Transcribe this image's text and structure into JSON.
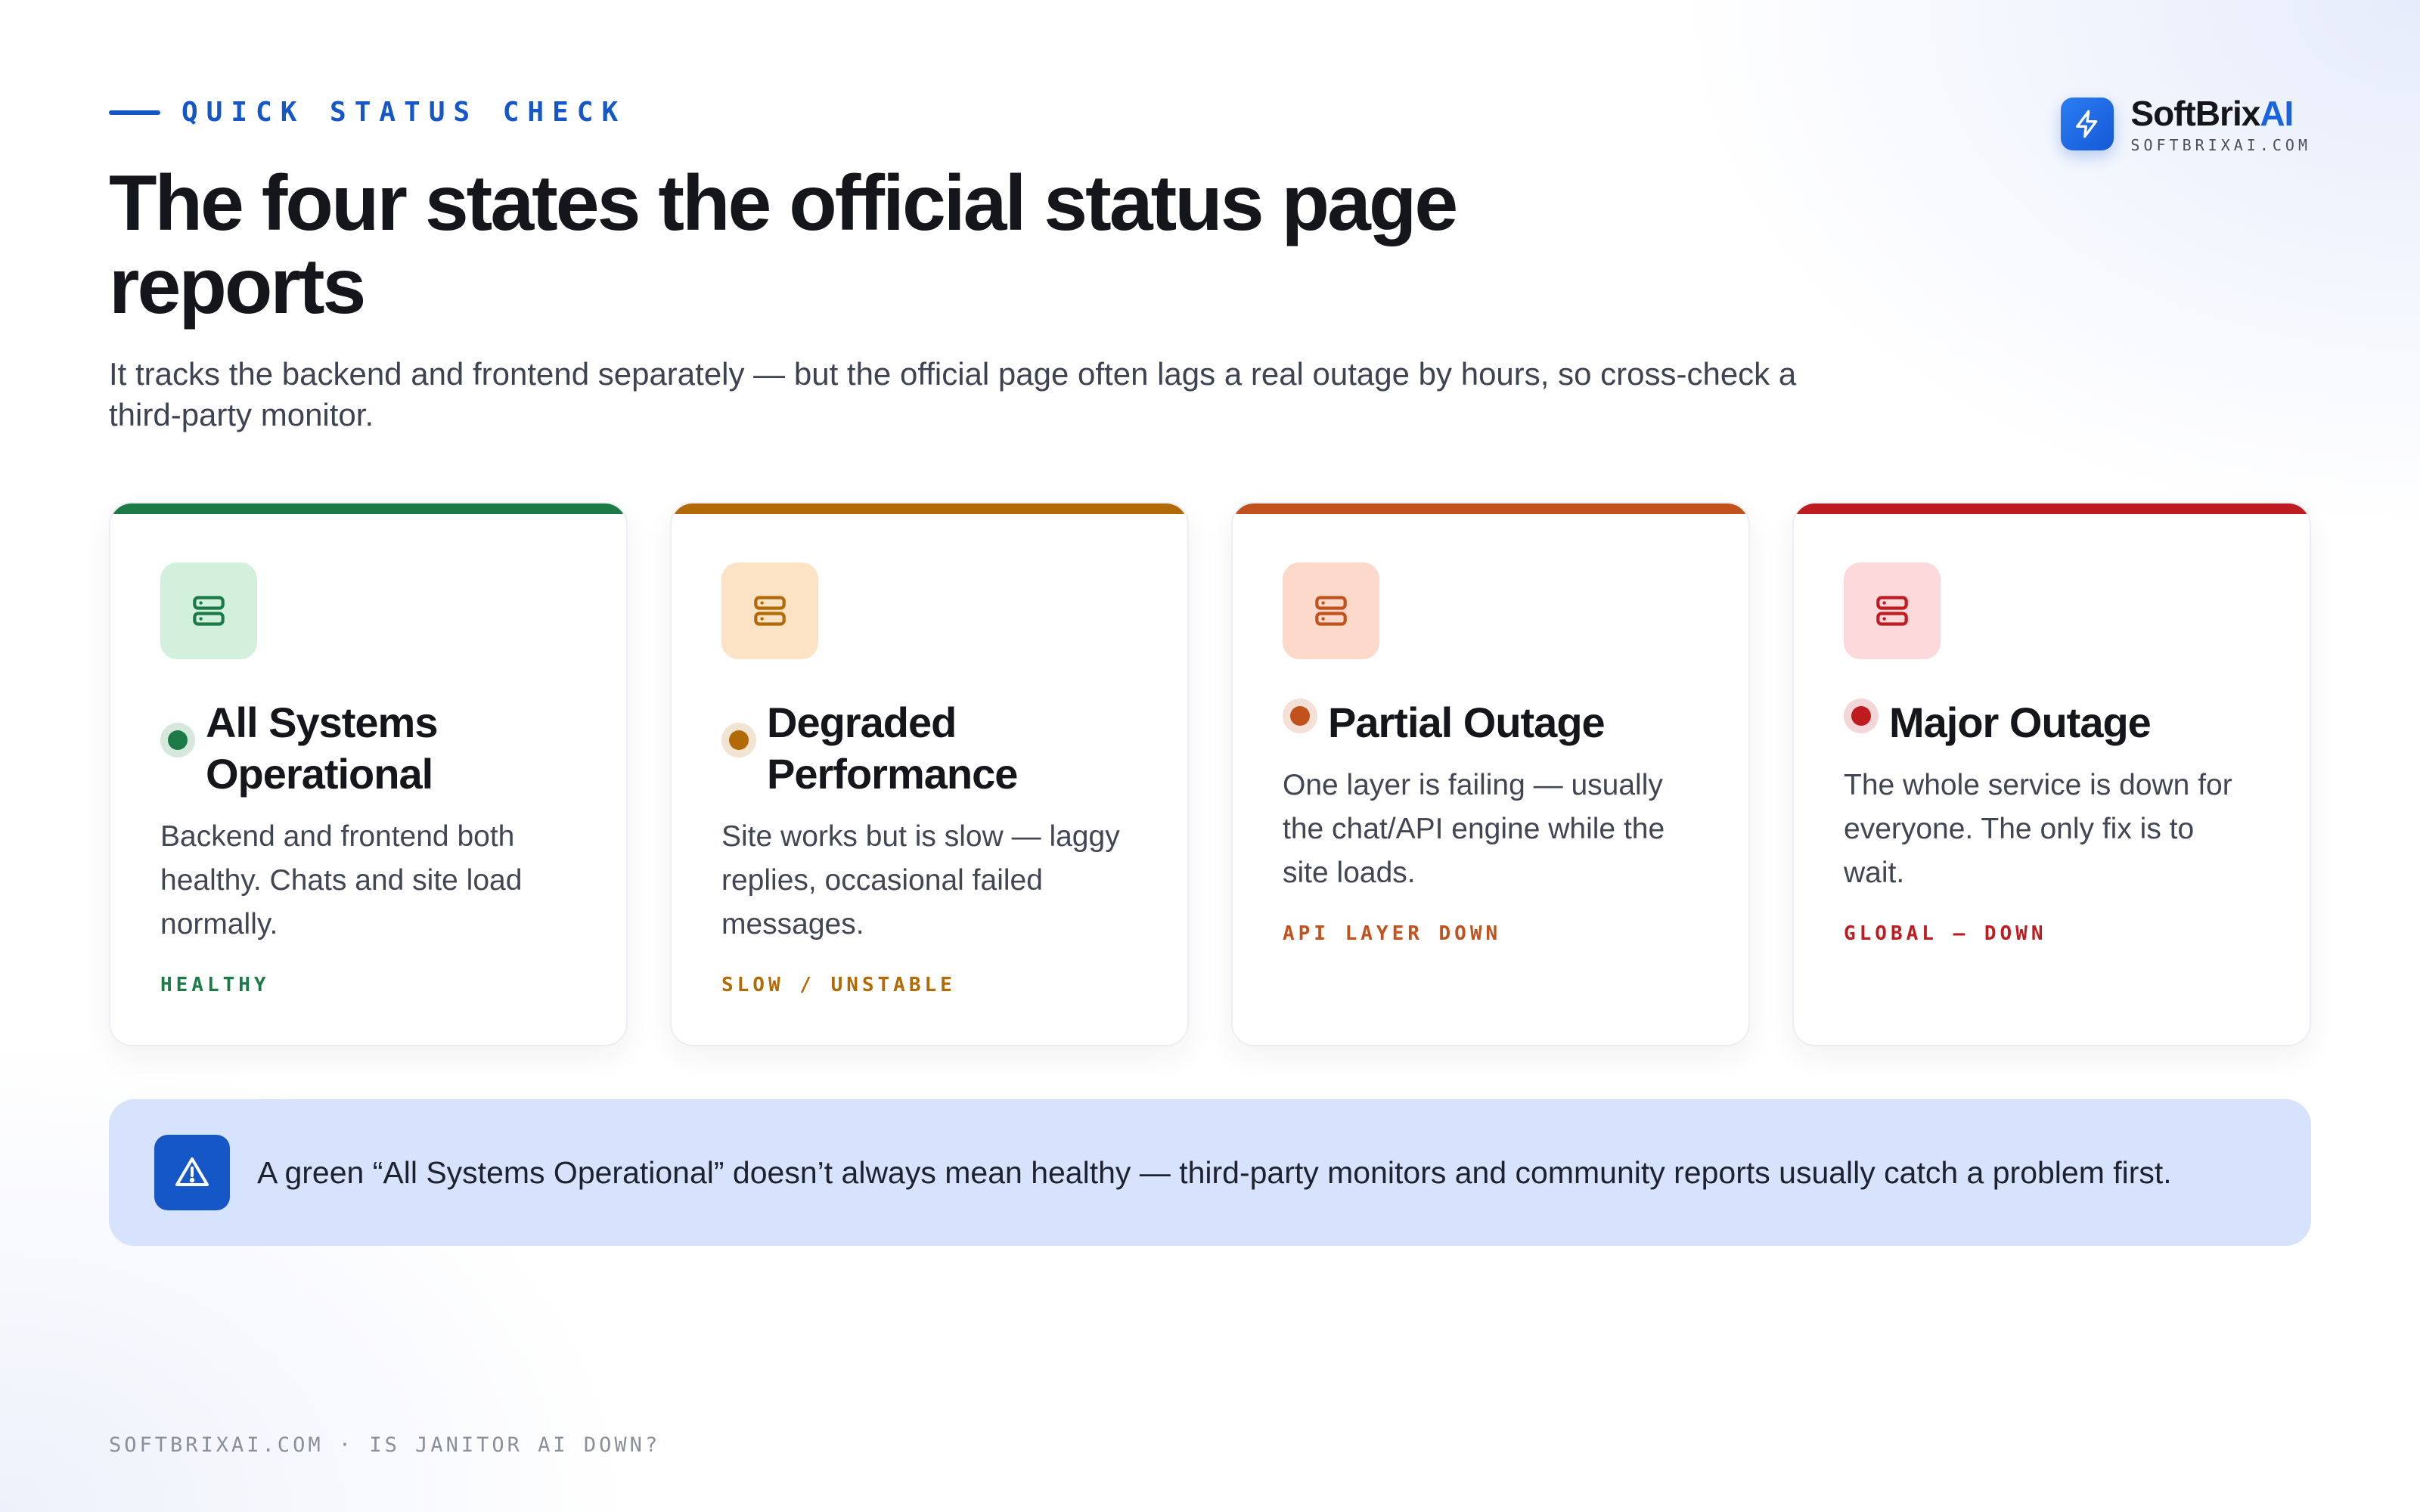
{
  "header": {
    "eyebrow": "QUICK STATUS CHECK",
    "title": "The four states the official status page reports",
    "subtitle": "It tracks the backend and frontend separately — but the official page often lags a real outage by hours, so cross-check a third-party monitor."
  },
  "brand": {
    "name_main": "SoftBrix",
    "name_accent": "AI",
    "url": "SOFTBRIXAI.COM",
    "icon": "lightning-bolt-icon",
    "accent_color": "#1a64e0"
  },
  "cards": [
    {
      "title": "All Systems Operational",
      "description": "Backend and frontend both healthy. Chats and site load normally.",
      "tag": "HEALTHY",
      "icon": "server-stack-icon",
      "color": "#1b7a45",
      "tile_color": "#d2f0dc"
    },
    {
      "title": "Degraded Performance",
      "description": "Site works but is slow — laggy replies, occasional failed messages.",
      "tag": "SLOW / UNSTABLE",
      "icon": "server-stack-icon",
      "color": "#b26a06",
      "tile_color": "#fde3c5"
    },
    {
      "title": "Partial Outage",
      "description": "One layer is failing — usually the chat/API engine while the site loads.",
      "tag": "API LAYER DOWN",
      "icon": "server-stack-icon",
      "color": "#c2521d",
      "tile_color": "#fcd9ca"
    },
    {
      "title": "Major Outage",
      "description": "The whole service is down for everyone. The only fix is to wait.",
      "tag": "GLOBAL — DOWN",
      "icon": "server-stack-icon",
      "color": "#bf1c22",
      "tile_color": "#fcd9da"
    }
  ],
  "callout": {
    "icon": "warning-triangle-icon",
    "text": "A green “All Systems Operational” doesn’t always mean healthy — third-party monitors and community reports usually catch a problem first."
  },
  "footer": {
    "text": "SOFTBRIXAI.COM · IS JANITOR AI DOWN?"
  }
}
